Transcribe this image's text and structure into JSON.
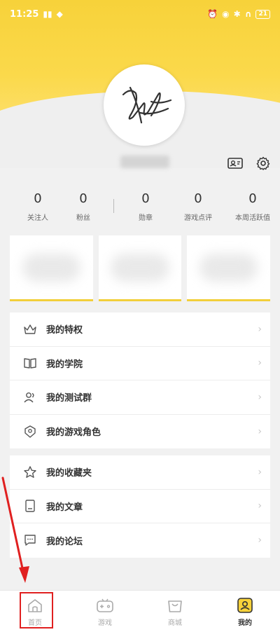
{
  "status_bar": {
    "time": "11:25",
    "signal": "ᵒᵒ|ıl",
    "battery": "21"
  },
  "profile": {
    "avatar_alt": "signature avatar"
  },
  "stats_left": [
    {
      "value": "0",
      "label": "关注人"
    },
    {
      "value": "0",
      "label": "粉丝"
    }
  ],
  "stats_right": [
    {
      "value": "0",
      "label": "勋章"
    },
    {
      "value": "0",
      "label": "游戏点评"
    },
    {
      "value": "0",
      "label": "本周活跃值"
    }
  ],
  "menu_group_1": [
    {
      "label": "我的特权",
      "icon": "crown-icon"
    },
    {
      "label": "我的学院",
      "icon": "book-icon"
    },
    {
      "label": "我的测试群",
      "icon": "group-icon"
    },
    {
      "label": "我的游戏角色",
      "icon": "shield-icon"
    }
  ],
  "menu_group_2": [
    {
      "label": "我的收藏夹",
      "icon": "star-icon"
    },
    {
      "label": "我的文章",
      "icon": "document-icon"
    },
    {
      "label": "我的论坛",
      "icon": "chat-icon"
    }
  ],
  "tabbar": [
    {
      "label": "首页",
      "icon": "home-icon"
    },
    {
      "label": "游戏",
      "icon": "gamepad-icon"
    },
    {
      "label": "商城",
      "icon": "shopping-bag-icon"
    },
    {
      "label": "我的",
      "icon": "profile-icon"
    }
  ],
  "colors": {
    "accent": "#f7d23a",
    "annotation": "#e02020"
  }
}
